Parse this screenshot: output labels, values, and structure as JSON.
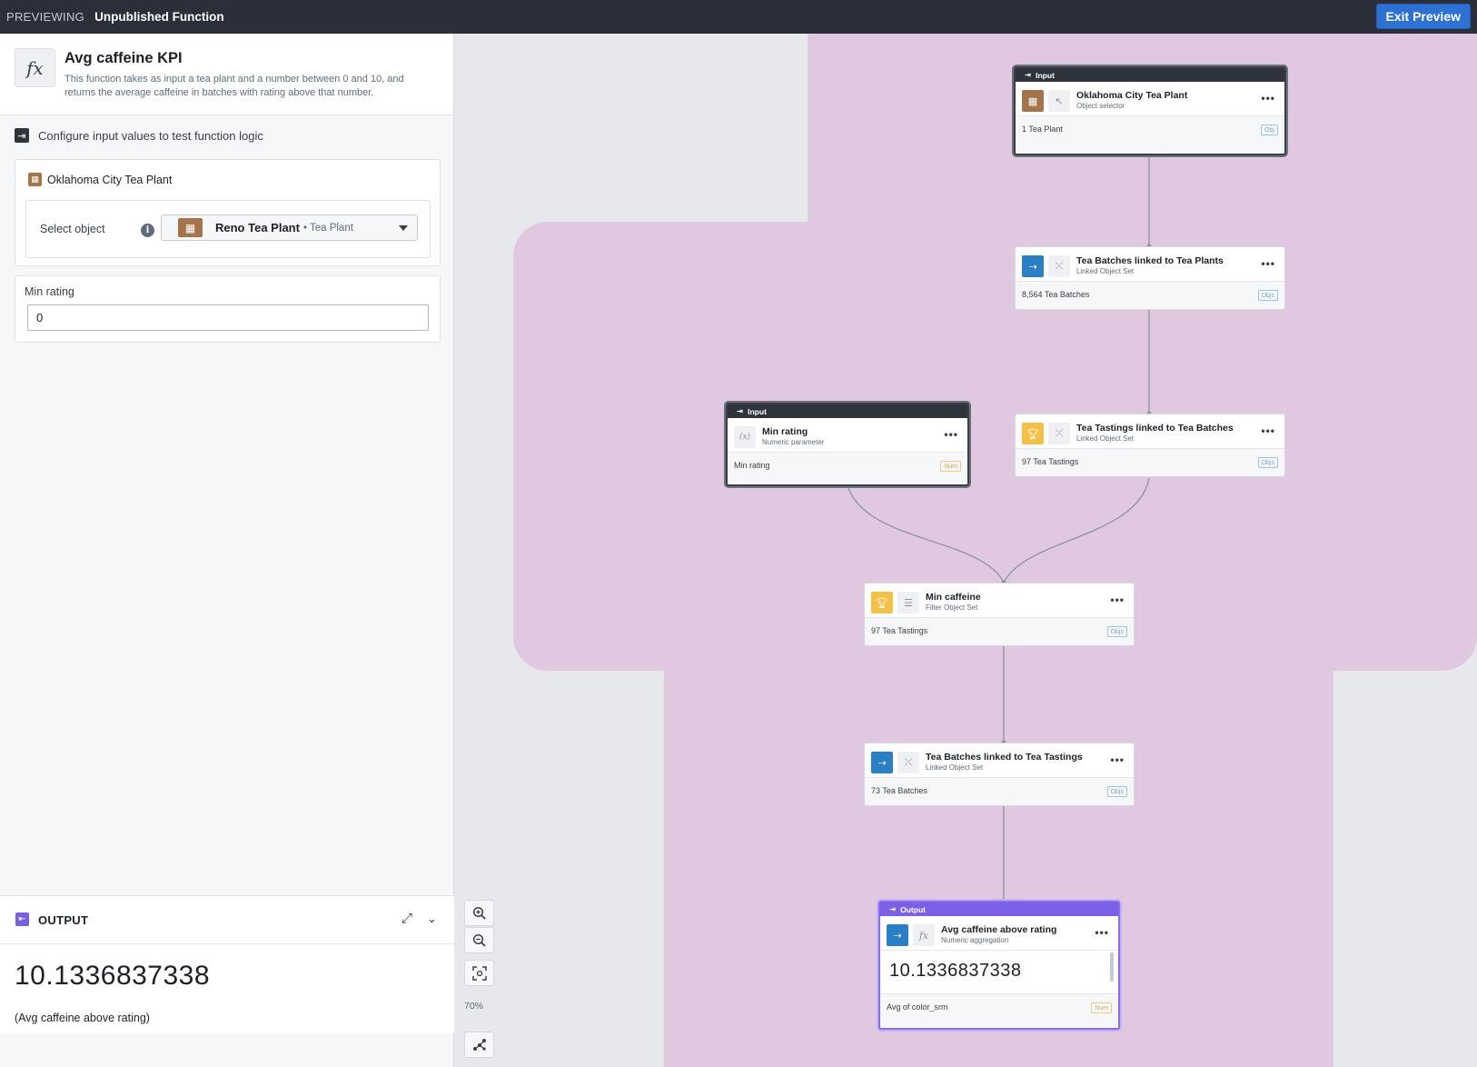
{
  "topbar": {
    "mode": "PREVIEWING",
    "function_name": "Unpublished Function",
    "exit_label": "Exit Preview"
  },
  "function": {
    "icon": "fx",
    "title": "Avg caffeine KPI",
    "description": "This function takes as input a tea plant and a number between 0 and 10, and returns the average caffeine in batches with rating above that number."
  },
  "configure": {
    "heading": "Configure input values to test function logic",
    "plant_label": "Oklahoma City Tea Plant",
    "select_label": "Select object",
    "selected_object": "Reno Tea Plant",
    "selected_type": "• Tea Plant",
    "min_rating_label": "Min rating",
    "min_rating_value": "0"
  },
  "output": {
    "title": "OUTPUT",
    "value": "10.1336837338",
    "caption": "(Avg caffeine above rating)"
  },
  "graph": {
    "zoom": "70%",
    "nodes": {
      "plant": {
        "header": "Input",
        "title": "Oklahoma City Tea Plant",
        "subtitle": "Object selector",
        "count": "1 Tea Plant",
        "badge": "Obj"
      },
      "batches": {
        "title": "Tea Batches linked to Tea Plants",
        "subtitle": "Linked Object Set",
        "count": "8,564 Tea Batches",
        "badge": "Objs"
      },
      "rating": {
        "header": "Input",
        "title": "Min rating",
        "subtitle": "Numeric parameter",
        "count": "Min rating",
        "badge": "Num"
      },
      "tastings": {
        "title": "Tea Tastings linked to Tea Batches",
        "subtitle": "Linked Object Set",
        "count": "97 Tea Tastings",
        "badge": "Objs"
      },
      "filter": {
        "title": "Min caffeine",
        "subtitle": "Filter Object Set",
        "count": "97 Tea Tastings",
        "badge": "Objs"
      },
      "batches2": {
        "title": "Tea Batches linked to Tea Tastings",
        "subtitle": "Linked Object Set",
        "count": "73 Tea Batches",
        "badge": "Objs"
      },
      "output": {
        "header": "Output",
        "title": "Avg caffeine above rating",
        "subtitle": "Numeric aggregation",
        "value": "10.1336837338",
        "count": "Avg of color_srm",
        "badge": "Num"
      }
    }
  },
  "colors": {
    "topbar": "#2a2f3a",
    "exit_button": "#2d72d2",
    "canvas_group": "#e0c9e0",
    "object_icon": "#a4754b",
    "linked_icon": "#2b7fc4",
    "tasting_icon": "#f5c046",
    "output_accent": "#7b5fe6"
  }
}
